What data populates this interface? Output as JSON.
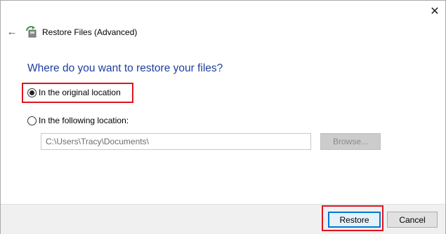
{
  "window": {
    "title": "Restore Files (Advanced)",
    "close_glyph": "✕",
    "back_glyph": "←",
    "close_icon": "close-icon",
    "back_icon": "back-arrow-icon",
    "app_icon": "restore-files-icon"
  },
  "main": {
    "heading": "Where do you want to restore your files?",
    "options": [
      {
        "label": "In the original location",
        "checked": true
      },
      {
        "label": "In the following location:",
        "checked": false
      }
    ],
    "path_value": "C:\\Users\\Tracy\\Documents\\",
    "browse_label": "Browse..."
  },
  "footer": {
    "restore_label": "Restore",
    "cancel_label": "Cancel"
  },
  "colors": {
    "heading": "#1e3ea0",
    "highlight": "#e0141e",
    "focus": "#0078d7"
  }
}
